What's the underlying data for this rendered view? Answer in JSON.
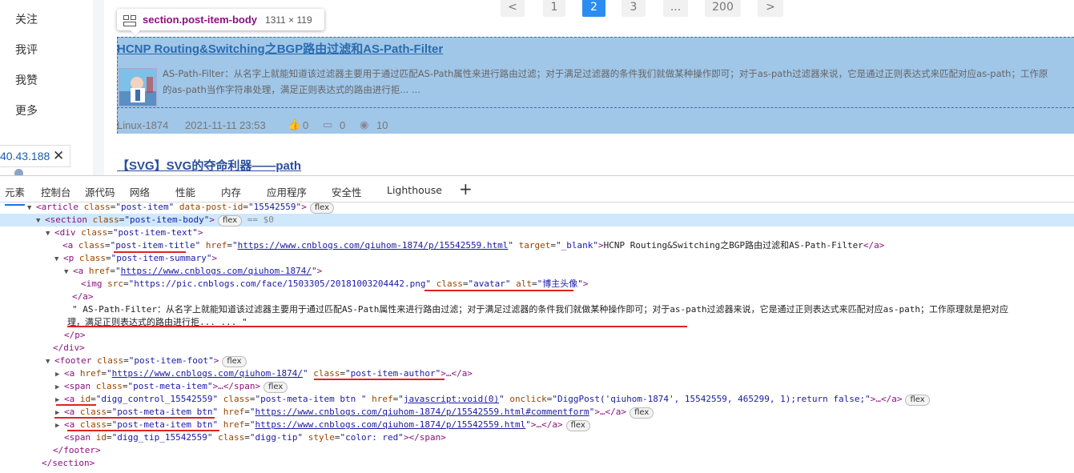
{
  "left_nav": {
    "items": [
      "关注",
      "我评",
      "我赞",
      "更多"
    ],
    "ip": "40.43.188"
  },
  "pager": [
    "<",
    "1",
    "2",
    "3",
    "...",
    "200",
    ">"
  ],
  "pager_active": "2",
  "tooltip": {
    "name": "section.post-item-body",
    "size": "1311 × 119"
  },
  "post": {
    "title": "HCNP Routing&Switching之BGP路由过滤和AS-Path-Filter",
    "summary_line1": "AS-Path-Filter：从名字上就能知道该过滤器主要用于通过匹配AS-Path属性来进行路由过滤；对于满足过滤器的条件我们就做某种操作即可；对于as-path过滤器来说，它是通过正则表达式来匹配对应as-path；工作原",
    "summary_line2": "的as-path当作字符串处理，满足正则表达式的路由进行拒... ...",
    "author": "Linux-1874",
    "date": "2021-11-11 23:53",
    "likes": "0",
    "comments": "0",
    "views": "10"
  },
  "post2": {
    "title": "【SVG】SVG的夺命利器——path"
  },
  "devtools": {
    "tabs": [
      "元素",
      "控制台",
      "源代码",
      "网络",
      "性能",
      "内存",
      "应用程序",
      "安全性",
      "Lighthouse"
    ],
    "active_tab": "元素"
  },
  "dom": {
    "r0": {
      "tag": "<article",
      "a1": "class",
      "v1": "\"post-item\"",
      "a2": "data-post-id",
      "v2": "\"15542559\"",
      "end": ">",
      "badge": "flex"
    },
    "r1": {
      "tag": "<section",
      "a1": "class",
      "v1": "\"post-item-body\"",
      "end": ">",
      "badge": "flex",
      "eq": "== $0"
    },
    "r2": {
      "tag": "<div",
      "a1": "class",
      "v1": "\"post-item-text\"",
      "end": ">"
    },
    "r3": {
      "tag": "<a",
      "a1": "class",
      "v1q": "\"",
      "v1": "post-item-title",
      "v1e": "\"",
      "a2": "href",
      "v2q": "\"",
      "v2": "https://www.cnblogs.com/qiuhom-1874/p/15542559.html",
      "v2e": "\"",
      "a3": "target",
      "v3": "\"_blank\"",
      "end": ">",
      "text": "HCNP Routing&Switching之BGP路由过滤和AS-Path-Filter",
      "close": "</a>"
    },
    "r4": {
      "tag": "<p",
      "a1": "class",
      "v1": "\"post-item-summary\"",
      "end": ">"
    },
    "r5": {
      "tag": "<a",
      "a1": "href",
      "v1q": "\"",
      "v1": "https://www.cnblogs.com/qiuhom-1874/",
      "v1e": "\"",
      "end": ">"
    },
    "r6": {
      "tag": "<img",
      "a1": "src",
      "v1": "\"https://pic.cnblogs.com/face/1503305/20181003204442.png\"",
      "a2": "class",
      "v2": "\"avatar\"",
      "a3": "alt",
      "v3": "\"博主头像\"",
      "end": ">"
    },
    "r7": {
      "close": "</a>"
    },
    "r8": {
      "text": "\" AS-Path-Filter：从名字上就能知道该过滤器主要用于通过匹配AS-Path属性来进行路由过滤；对于满足过滤器的条件我们就做某种操作即可；对于as-path过滤器来说，它是通过正则表达式来匹配对应as-path；工作原理就是把对应"
    },
    "r9": {
      "text": "理，满足正则表达式的路由进行拒... ... \""
    },
    "r10": {
      "close": "</p>"
    },
    "r11": {
      "close": "</div>"
    },
    "r12": {
      "tag": "<footer",
      "a1": "class",
      "v1": "\"post-item-foot\"",
      "end": ">",
      "badge": "flex"
    },
    "r13": {
      "tag": "<a",
      "a1": "href",
      "v1q": "\"",
      "v1": "https://www.cnblogs.com/qiuhom-1874/",
      "v1e": "\"",
      "a2": "class",
      "v2": "\"post-item-author\"",
      "end": ">…</a>"
    },
    "r14": {
      "tag": "<span",
      "a1": "class",
      "v1": "\"post-meta-item\"",
      "end": ">…</span>",
      "badge": "flex"
    },
    "r15": {
      "tag": "<a",
      "a1": "id",
      "v1": "\"digg_control_15542559\"",
      "a2": "class",
      "v2": "\"post-meta-item btn \"",
      "a3": "href",
      "v3q": "\"",
      "v3": "javascript:void(0)",
      "v3e": "\"",
      "a4": "onclick",
      "v4": "\"DiggPost('qiuhom-1874', 15542559, 465299, 1);return false;\"",
      "end": ">…</a>",
      "badge": "flex"
    },
    "r16": {
      "tag": "<a",
      "a1": "class",
      "v1": "\"post-meta-item btn\"",
      "a2": "href",
      "v2q": "\"",
      "v2": "https://www.cnblogs.com/qiuhom-1874/p/15542559.html#commentform",
      "v2e": "\"",
      "end": ">…</a>",
      "badge": "flex"
    },
    "r17": {
      "tag": "<a",
      "a1": "class",
      "v1": "\"post-meta-item btn\"",
      "a2": "href",
      "v2q": "\"",
      "v2": "https://www.cnblogs.com/qiuhom-1874/p/15542559.html",
      "v2e": "\"",
      "end": ">…</a>",
      "badge": "flex"
    },
    "r18": {
      "tag": "<span",
      "a1": "id",
      "v1": "\"digg_tip_15542559\"",
      "a2": "class",
      "v2": "\"digg-tip\"",
      "a3": "style",
      "v3": "\"color: red\"",
      "end": "></span>"
    },
    "r19": {
      "close": "</footer>"
    },
    "r20": {
      "close": "</section>"
    }
  },
  "colors": {
    "highlight": "#6fa8dc",
    "accent": "#2d8cf0",
    "annotation": "#e0241f"
  }
}
